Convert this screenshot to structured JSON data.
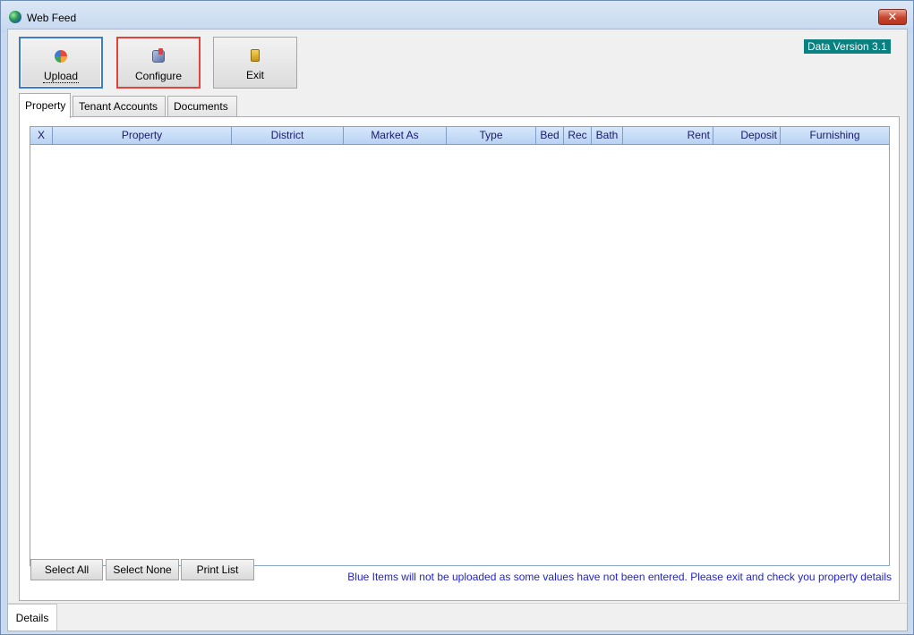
{
  "window": {
    "title": "Web Feed",
    "close_label": "✕"
  },
  "toolbar": {
    "upload_label": "Upload",
    "configure_label": "Configure",
    "exit_label": "Exit"
  },
  "version_badge": "Data Version 3.1",
  "tabs": [
    {
      "label": "Property",
      "active": true
    },
    {
      "label": "Tenant Accounts",
      "active": false
    },
    {
      "label": "Documents",
      "active": false
    }
  ],
  "grid": {
    "columns": [
      "X",
      "Property",
      "District",
      "Market As",
      "Type",
      "Bed",
      "Rec",
      "Bath",
      "Rent",
      "Deposit",
      "Furnishing"
    ],
    "rows": []
  },
  "footer": {
    "select_all_label": "Select All",
    "select_none_label": "Select None",
    "print_list_label": "Print List",
    "notice": "Blue Items will not be uploaded as some values have not been entered. Please exit and check you property details"
  },
  "status": {
    "details_tab": "Details"
  },
  "colors": {
    "accent_blue": "#3d7bd1",
    "highlight_red": "#e0433a",
    "badge_teal": "#0a8080",
    "notice_blue": "#1f1fd4"
  }
}
